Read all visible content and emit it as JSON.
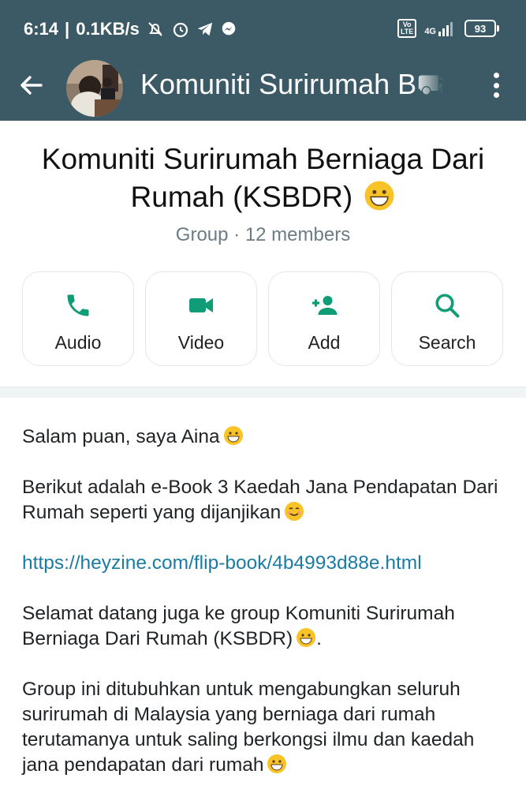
{
  "status_bar": {
    "time": "6:14",
    "net_speed": "0.1KB/s",
    "network": "4G",
    "volte": "Vo LTE",
    "battery": "93"
  },
  "app_bar": {
    "title": "Komuniti Surirumah B⛟"
  },
  "group": {
    "name_line1": "Komuniti Surirumah Berniaga Dari",
    "name_line2": "Rumah (KSBDR)",
    "subtitle": "Group · 12 members"
  },
  "actions": [
    {
      "label": "Audio",
      "icon": "phone-icon"
    },
    {
      "label": "Video",
      "icon": "video-camera-icon"
    },
    {
      "label": "Add",
      "icon": "add-person-icon"
    },
    {
      "label": "Search",
      "icon": "search-icon"
    }
  ],
  "description": {
    "p1": "Salam puan, saya Aina",
    "p2": "Berikut adalah e-Book 3 Kaedah Jana Pendapatan Dari Rumah seperti yang dijanjikan",
    "link": "https://heyzine.com/flip-book/4b4993d88e.html",
    "p3": "Selamat datang juga ke group Komuniti Surirumah Berniaga Dari Rumah (KSBDR)",
    "p3_end": ".",
    "p4": "Group ini ditubuhkan untuk mengabungkan seluruh surirumah di Malaysia yang berniaga dari rumah terutamanya untuk saling berkongsi ilmu dan kaedah jana pendapatan dari rumah"
  },
  "colors": {
    "header": "#3b5a66",
    "accent_green": "#0f9d77",
    "link": "#1a7ba5"
  }
}
